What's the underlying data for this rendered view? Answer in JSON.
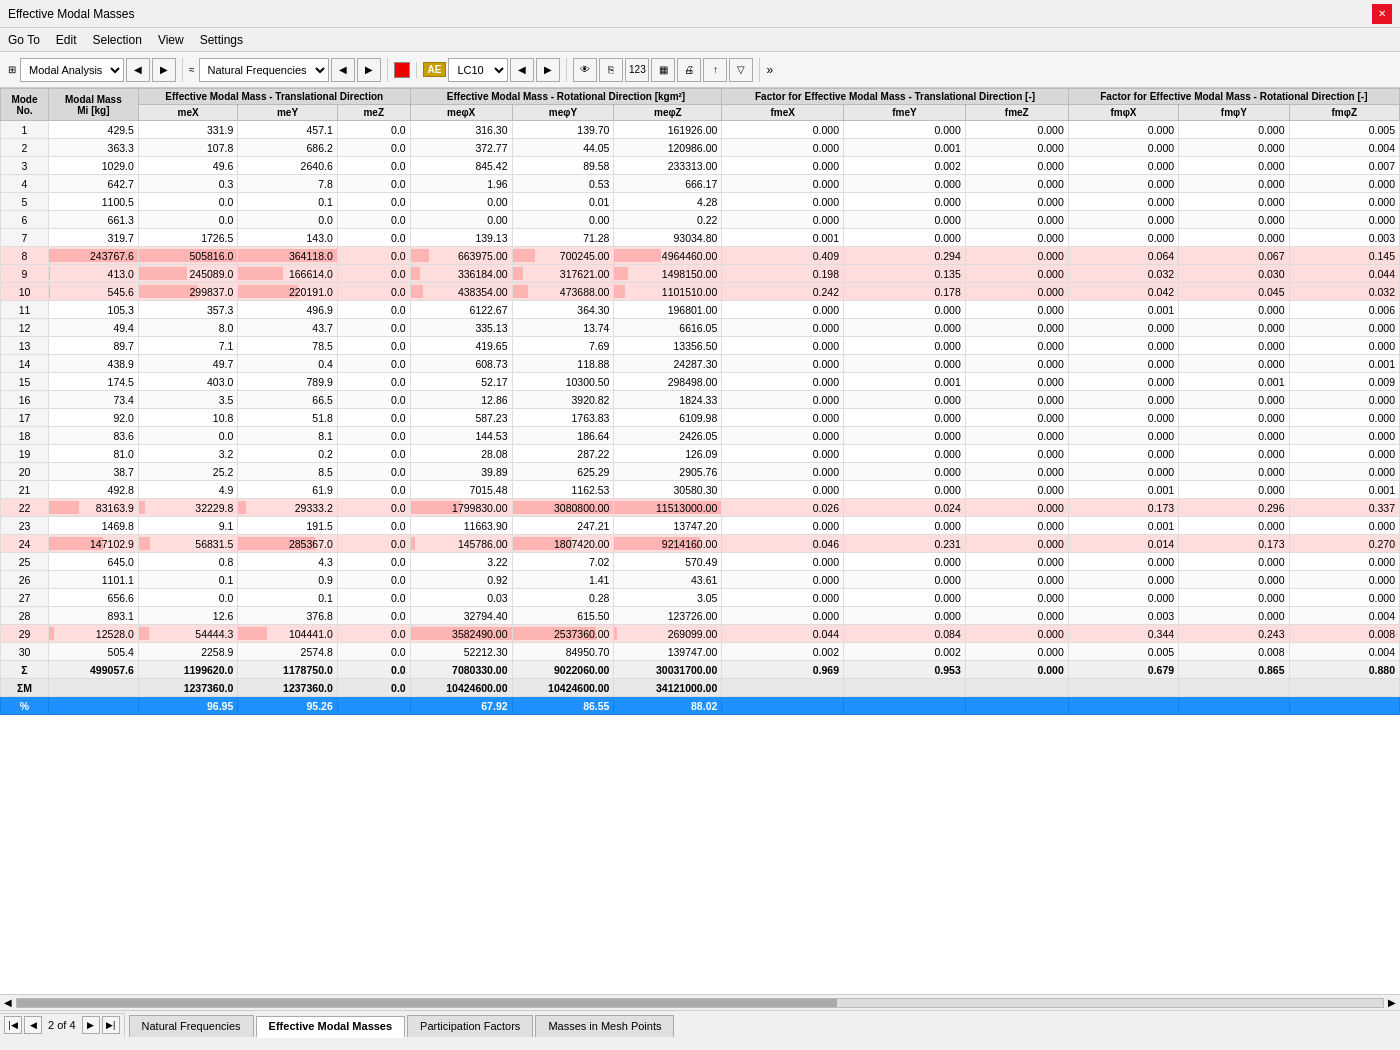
{
  "titleBar": {
    "title": "Effective Modal Masses",
    "closeLabel": "✕"
  },
  "menuBar": {
    "items": [
      "Go To",
      "Edit",
      "Selection",
      "View",
      "Settings"
    ]
  },
  "toolbar": {
    "dropdown1": "Modal Analysis",
    "dropdown2": "Natural Frequencies",
    "colorBox": "#cc0000",
    "aeBadge": "AE",
    "lcValue": "LC10"
  },
  "table": {
    "colGroups": [
      {
        "label": "",
        "span": 1
      },
      {
        "label": "Modal Mass",
        "span": 1
      },
      {
        "label": "Effective Modal Mass - Translational Direction",
        "span": 3
      },
      {
        "label": "Effective Modal Mass - Rotational Direction [kgm²]",
        "span": 3
      },
      {
        "label": "Factor for Effective Modal Mass - Translational Direction [-]",
        "span": 3
      },
      {
        "label": "Factor for Effective Modal Mass - Rotational Direction [-]",
        "span": 3
      }
    ],
    "headers": [
      "Mode\nNo.",
      "Mi [kg]",
      "meX",
      "meY",
      "meZ",
      "meφX",
      "meφY",
      "meφZ",
      "fmeX",
      "fmeY",
      "fmeZ",
      "fmφX",
      "fmφY",
      "fmφZ"
    ],
    "rows": [
      {
        "mode": 1,
        "mi": "429.5",
        "mex": "331.9",
        "mey": "457.1",
        "mez": "0.0",
        "mephix": "316.30",
        "mephiy": "139.70",
        "mephiz": "161926.00",
        "fmex": "0.000",
        "fmey": "0.000",
        "fmez": "0.000",
        "fmphix": "0.000",
        "fmphiy": "0.000",
        "fmphiz": "0.005",
        "highlight": false
      },
      {
        "mode": 2,
        "mi": "363.3",
        "mex": "107.8",
        "mey": "686.2",
        "mez": "0.0",
        "mephix": "372.77",
        "mephiy": "44.05",
        "mephiz": "120986.00",
        "fmex": "0.000",
        "fmey": "0.001",
        "fmez": "0.000",
        "fmphix": "0.000",
        "fmphiy": "0.000",
        "fmphiz": "0.004",
        "highlight": false
      },
      {
        "mode": 3,
        "mi": "1029.0",
        "mex": "49.6",
        "mey": "2640.6",
        "mez": "0.0",
        "mephix": "845.42",
        "mephiy": "89.58",
        "mephiz": "233313.00",
        "fmex": "0.000",
        "fmey": "0.002",
        "fmez": "0.000",
        "fmphix": "0.000",
        "fmphiy": "0.000",
        "fmphiz": "0.007",
        "highlight": false
      },
      {
        "mode": 4,
        "mi": "642.7",
        "mex": "0.3",
        "mey": "7.8",
        "mez": "0.0",
        "mephix": "1.96",
        "mephiy": "0.53",
        "mephiz": "666.17",
        "fmex": "0.000",
        "fmey": "0.000",
        "fmez": "0.000",
        "fmphix": "0.000",
        "fmphiy": "0.000",
        "fmphiz": "0.000",
        "highlight": false
      },
      {
        "mode": 5,
        "mi": "1100.5",
        "mex": "0.0",
        "mey": "0.1",
        "mez": "0.0",
        "mephix": "0.00",
        "mephiy": "0.01",
        "mephiz": "4.28",
        "fmex": "0.000",
        "fmey": "0.000",
        "fmez": "0.000",
        "fmphix": "0.000",
        "fmphiy": "0.000",
        "fmphiz": "0.000",
        "highlight": false
      },
      {
        "mode": 6,
        "mi": "661.3",
        "mex": "0.0",
        "mey": "0.0",
        "mez": "0.0",
        "mephix": "0.00",
        "mephiy": "0.00",
        "mephiz": "0.22",
        "fmex": "0.000",
        "fmey": "0.000",
        "fmez": "0.000",
        "fmphix": "0.000",
        "fmphiy": "0.000",
        "fmphiz": "0.000",
        "highlight": false
      },
      {
        "mode": 7,
        "mi": "319.7",
        "mex": "1726.5",
        "mey": "143.0",
        "mez": "0.0",
        "mephix": "139.13",
        "mephiy": "71.28",
        "mephiz": "93034.80",
        "fmex": "0.001",
        "fmey": "0.000",
        "fmez": "0.000",
        "fmphix": "0.000",
        "fmphiy": "0.000",
        "fmphiz": "0.003",
        "highlight": false
      },
      {
        "mode": 8,
        "mi": "243767.6",
        "mex": "505816.0",
        "mey": "364118.0",
        "mez": "0.0",
        "mephix": "663975.00",
        "mephiy": "700245.00",
        "mephiz": "4964460.00",
        "fmex": "0.409",
        "fmey": "0.294",
        "fmez": "0.000",
        "fmphix": "0.064",
        "fmphiy": "0.067",
        "fmphiz": "0.145",
        "highlight": true
      },
      {
        "mode": 9,
        "mi": "413.0",
        "mex": "245089.0",
        "mey": "166614.0",
        "mez": "0.0",
        "mephix": "336184.00",
        "mephiy": "317621.00",
        "mephiz": "1498150.00",
        "fmex": "0.198",
        "fmey": "0.135",
        "fmez": "0.000",
        "fmphix": "0.032",
        "fmphiy": "0.030",
        "fmphiz": "0.044",
        "highlight": true
      },
      {
        "mode": 10,
        "mi": "545.6",
        "mex": "299837.0",
        "mey": "220191.0",
        "mez": "0.0",
        "mephix": "438354.00",
        "mephiy": "473688.00",
        "mephiz": "1101510.00",
        "fmex": "0.242",
        "fmey": "0.178",
        "fmez": "0.000",
        "fmphix": "0.042",
        "fmphiy": "0.045",
        "fmphiz": "0.032",
        "highlight": true
      },
      {
        "mode": 11,
        "mi": "105.3",
        "mex": "357.3",
        "mey": "496.9",
        "mez": "0.0",
        "mephix": "6122.67",
        "mephiy": "364.30",
        "mephiz": "196801.00",
        "fmex": "0.000",
        "fmey": "0.000",
        "fmez": "0.000",
        "fmphix": "0.001",
        "fmphiy": "0.000",
        "fmphiz": "0.006",
        "highlight": false
      },
      {
        "mode": 12,
        "mi": "49.4",
        "mex": "8.0",
        "mey": "43.7",
        "mez": "0.0",
        "mephix": "335.13",
        "mephiy": "13.74",
        "mephiz": "6616.05",
        "fmex": "0.000",
        "fmey": "0.000",
        "fmez": "0.000",
        "fmphix": "0.000",
        "fmphiy": "0.000",
        "fmphiz": "0.000",
        "highlight": false
      },
      {
        "mode": 13,
        "mi": "89.7",
        "mex": "7.1",
        "mey": "78.5",
        "mez": "0.0",
        "mephix": "419.65",
        "mephiy": "7.69",
        "mephiz": "13356.50",
        "fmex": "0.000",
        "fmey": "0.000",
        "fmez": "0.000",
        "fmphix": "0.000",
        "fmphiy": "0.000",
        "fmphiz": "0.000",
        "highlight": false
      },
      {
        "mode": 14,
        "mi": "438.9",
        "mex": "49.7",
        "mey": "0.4",
        "mez": "0.0",
        "mephix": "608.73",
        "mephiy": "118.88",
        "mephiz": "24287.30",
        "fmex": "0.000",
        "fmey": "0.000",
        "fmez": "0.000",
        "fmphix": "0.000",
        "fmphiy": "0.000",
        "fmphiz": "0.001",
        "highlight": false
      },
      {
        "mode": 15,
        "mi": "174.5",
        "mex": "403.0",
        "mey": "789.9",
        "mez": "0.0",
        "mephix": "52.17",
        "mephiy": "10300.50",
        "mephiz": "298498.00",
        "fmex": "0.000",
        "fmey": "0.001",
        "fmez": "0.000",
        "fmphix": "0.000",
        "fmphiy": "0.001",
        "fmphiz": "0.009",
        "highlight": false
      },
      {
        "mode": 16,
        "mi": "73.4",
        "mex": "3.5",
        "mey": "66.5",
        "mez": "0.0",
        "mephix": "12.86",
        "mephiy": "3920.82",
        "mephiz": "1824.33",
        "fmex": "0.000",
        "fmey": "0.000",
        "fmez": "0.000",
        "fmphix": "0.000",
        "fmphiy": "0.000",
        "fmphiz": "0.000",
        "highlight": false
      },
      {
        "mode": 17,
        "mi": "92.0",
        "mex": "10.8",
        "mey": "51.8",
        "mez": "0.0",
        "mephix": "587.23",
        "mephiy": "1763.83",
        "mephiz": "6109.98",
        "fmex": "0.000",
        "fmey": "0.000",
        "fmez": "0.000",
        "fmphix": "0.000",
        "fmphiy": "0.000",
        "fmphiz": "0.000",
        "highlight": false
      },
      {
        "mode": 18,
        "mi": "83.6",
        "mex": "0.0",
        "mey": "8.1",
        "mez": "0.0",
        "mephix": "144.53",
        "mephiy": "186.64",
        "mephiz": "2426.05",
        "fmex": "0.000",
        "fmey": "0.000",
        "fmez": "0.000",
        "fmphix": "0.000",
        "fmphiy": "0.000",
        "fmphiz": "0.000",
        "highlight": false
      },
      {
        "mode": 19,
        "mi": "81.0",
        "mex": "3.2",
        "mey": "0.2",
        "mez": "0.0",
        "mephix": "28.08",
        "mephiy": "287.22",
        "mephiz": "126.09",
        "fmex": "0.000",
        "fmey": "0.000",
        "fmez": "0.000",
        "fmphix": "0.000",
        "fmphiy": "0.000",
        "fmphiz": "0.000",
        "highlight": false
      },
      {
        "mode": 20,
        "mi": "38.7",
        "mex": "25.2",
        "mey": "8.5",
        "mez": "0.0",
        "mephix": "39.89",
        "mephiy": "625.29",
        "mephiz": "2905.76",
        "fmex": "0.000",
        "fmey": "0.000",
        "fmez": "0.000",
        "fmphix": "0.000",
        "fmphiy": "0.000",
        "fmphiz": "0.000",
        "highlight": false
      },
      {
        "mode": 21,
        "mi": "492.8",
        "mex": "4.9",
        "mey": "61.9",
        "mez": "0.0",
        "mephix": "7015.48",
        "mephiy": "1162.53",
        "mephiz": "30580.30",
        "fmex": "0.000",
        "fmey": "0.000",
        "fmez": "0.000",
        "fmphix": "0.001",
        "fmphiy": "0.000",
        "fmphiz": "0.001",
        "highlight": false
      },
      {
        "mode": 22,
        "mi": "83163.9",
        "mex": "32229.8",
        "mey": "29333.2",
        "mez": "0.0",
        "mephix": "1799830.00",
        "mephiy": "3080800.00",
        "mephiz": "11513000.00",
        "fmex": "0.026",
        "fmey": "0.024",
        "fmez": "0.000",
        "fmphix": "0.173",
        "fmphiy": "0.296",
        "fmphiz": "0.337",
        "highlight": true
      },
      {
        "mode": 23,
        "mi": "1469.8",
        "mex": "9.1",
        "mey": "191.5",
        "mez": "0.0",
        "mephix": "11663.90",
        "mephiy": "247.21",
        "mephiz": "13747.20",
        "fmex": "0.000",
        "fmey": "0.000",
        "fmez": "0.000",
        "fmphix": "0.001",
        "fmphiy": "0.000",
        "fmphiz": "0.000",
        "highlight": false
      },
      {
        "mode": 24,
        "mi": "147102.9",
        "mex": "56831.5",
        "mey": "285367.0",
        "mez": "0.0",
        "mephix": "145786.00",
        "mephiy": "1807420.00",
        "mephiz": "9214160.00",
        "fmex": "0.046",
        "fmey": "0.231",
        "fmez": "0.000",
        "fmphix": "0.014",
        "fmphiy": "0.173",
        "fmphiz": "0.270",
        "highlight": true
      },
      {
        "mode": 25,
        "mi": "645.0",
        "mex": "0.8",
        "mey": "4.3",
        "mez": "0.0",
        "mephix": "3.22",
        "mephiy": "7.02",
        "mephiz": "570.49",
        "fmex": "0.000",
        "fmey": "0.000",
        "fmez": "0.000",
        "fmphix": "0.000",
        "fmphiy": "0.000",
        "fmphiz": "0.000",
        "highlight": false
      },
      {
        "mode": 26,
        "mi": "1101.1",
        "mex": "0.1",
        "mey": "0.9",
        "mez": "0.0",
        "mephix": "0.92",
        "mephiy": "1.41",
        "mephiz": "43.61",
        "fmex": "0.000",
        "fmey": "0.000",
        "fmez": "0.000",
        "fmphix": "0.000",
        "fmphiy": "0.000",
        "fmphiz": "0.000",
        "highlight": false
      },
      {
        "mode": 27,
        "mi": "656.6",
        "mex": "0.0",
        "mey": "0.1",
        "mez": "0.0",
        "mephix": "0.03",
        "mephiy": "0.28",
        "mephiz": "3.05",
        "fmex": "0.000",
        "fmey": "0.000",
        "fmez": "0.000",
        "fmphix": "0.000",
        "fmphiy": "0.000",
        "fmphiz": "0.000",
        "highlight": false
      },
      {
        "mode": 28,
        "mi": "893.1",
        "mex": "12.6",
        "mey": "376.8",
        "mez": "0.0",
        "mephix": "32794.40",
        "mephiy": "615.50",
        "mephiz": "123726.00",
        "fmex": "0.000",
        "fmey": "0.000",
        "fmez": "0.000",
        "fmphix": "0.003",
        "fmphiy": "0.000",
        "fmphiz": "0.004",
        "highlight": false
      },
      {
        "mode": 29,
        "mi": "12528.0",
        "mex": "54444.3",
        "mey": "104441.0",
        "mez": "0.0",
        "mephix": "3582490.00",
        "mephiy": "2537360.00",
        "mephiz": "269099.00",
        "fmex": "0.044",
        "fmey": "0.084",
        "fmez": "0.000",
        "fmphix": "0.344",
        "fmphiy": "0.243",
        "fmphiz": "0.008",
        "highlight": true
      },
      {
        "mode": 30,
        "mi": "505.4",
        "mex": "2258.9",
        "mey": "2574.8",
        "mez": "0.0",
        "mephix": "52212.30",
        "mephiy": "84950.70",
        "mephiz": "139747.00",
        "fmex": "0.002",
        "fmey": "0.002",
        "fmez": "0.000",
        "fmphix": "0.005",
        "fmphiy": "0.008",
        "fmphiz": "0.004",
        "highlight": false
      }
    ],
    "sumRow": {
      "label": "Σ",
      "mi": "499057.6",
      "mex": "1199620.0",
      "mey": "1178750.0",
      "mez": "0.0",
      "mephix": "7080330.00",
      "mephiy": "9022060.00",
      "mephiz": "30031700.00",
      "fmex": "0.969",
      "fmey": "0.953",
      "fmez": "0.000",
      "fmphix": "0.679",
      "fmphiy": "0.865",
      "fmphiz": "0.880"
    },
    "summRow": {
      "label": "ΣM",
      "mi": "",
      "mex": "1237360.0",
      "mey": "1237360.0",
      "mez": "0.0",
      "mephix": "10424600.00",
      "mephiy": "10424600.00",
      "mephiz": "34121000.00",
      "fmex": "",
      "fmey": "",
      "fmez": "",
      "fmphix": "",
      "fmphiy": "",
      "fmphiz": ""
    },
    "percentRow": {
      "label": "%",
      "mex": "96.95",
      "mey": "95.26",
      "mez": "",
      "mephix": "67.92",
      "mephiy": "86.55",
      "mephiz": "88.02"
    }
  },
  "tabs": {
    "items": [
      "Natural Frequencies",
      "Effective Modal Masses",
      "Participation Factors",
      "Masses in Mesh Points"
    ],
    "active": 1
  },
  "pageNav": {
    "current": "2",
    "total": "4"
  }
}
